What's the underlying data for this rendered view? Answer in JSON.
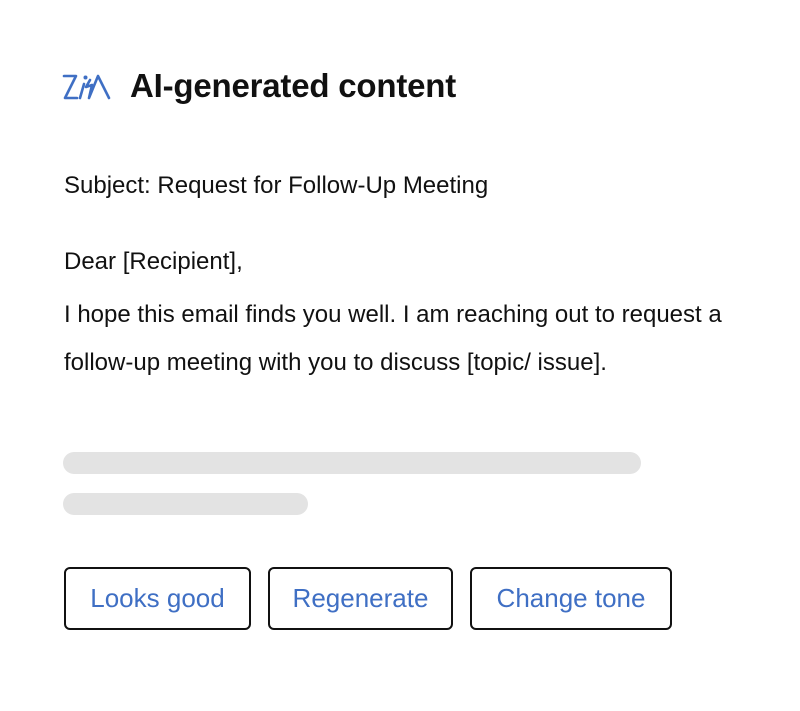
{
  "header": {
    "icon": "zia-ai-icon",
    "title": "AI-generated content"
  },
  "email": {
    "subject": "Subject: Request for Follow-Up Meeting",
    "greeting": "Dear [Recipient],",
    "body": "I hope this email finds you well. I am reaching out to request a follow-up meeting with you to discuss [topic/ issue]."
  },
  "actions": {
    "looks_good": "Looks good",
    "regenerate": "Regenerate",
    "change_tone": "Change tone"
  },
  "colors": {
    "accent": "#3f6fc4",
    "text": "#111111",
    "skeleton": "#e3e3e3"
  }
}
